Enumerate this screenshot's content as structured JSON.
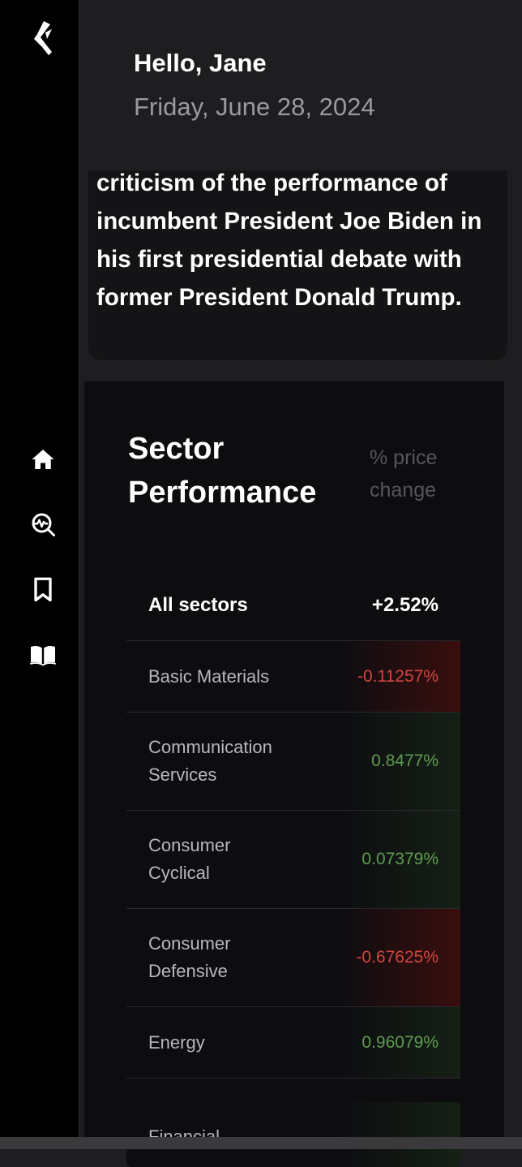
{
  "greeting": "Hello, Jane",
  "date": "Friday, June 28, 2024",
  "news": {
    "text": "criticism of the performance of incumbent President Joe Biden in his first presidential debate with former President Donald Trump."
  },
  "nav": [
    {
      "name": "home-icon"
    },
    {
      "name": "market-search-icon"
    },
    {
      "name": "bookmark-icon"
    },
    {
      "name": "book-icon"
    }
  ],
  "sectors": {
    "title": "Sector Performance",
    "subtitle": "% price change",
    "all": {
      "label": "All sectors",
      "value": "+2.52%"
    },
    "rows": [
      {
        "label": "Basic Materials",
        "value": "-0.11257%",
        "trend": "neg"
      },
      {
        "label": "Communication Services",
        "value": "0.8477%",
        "trend": "pos"
      },
      {
        "label": "Consumer Cyclical",
        "value": "0.07379%",
        "trend": "pos"
      },
      {
        "label": "Consumer Defensive",
        "value": "-0.67625%",
        "trend": "neg"
      },
      {
        "label": "Energy",
        "value": "0.96079%",
        "trend": "pos"
      }
    ],
    "next_label": "Financial"
  },
  "colors": {
    "negative": "#d2453f",
    "positive": "#5f9b52",
    "sidebar": "#000000",
    "card": "#0d0d10"
  }
}
